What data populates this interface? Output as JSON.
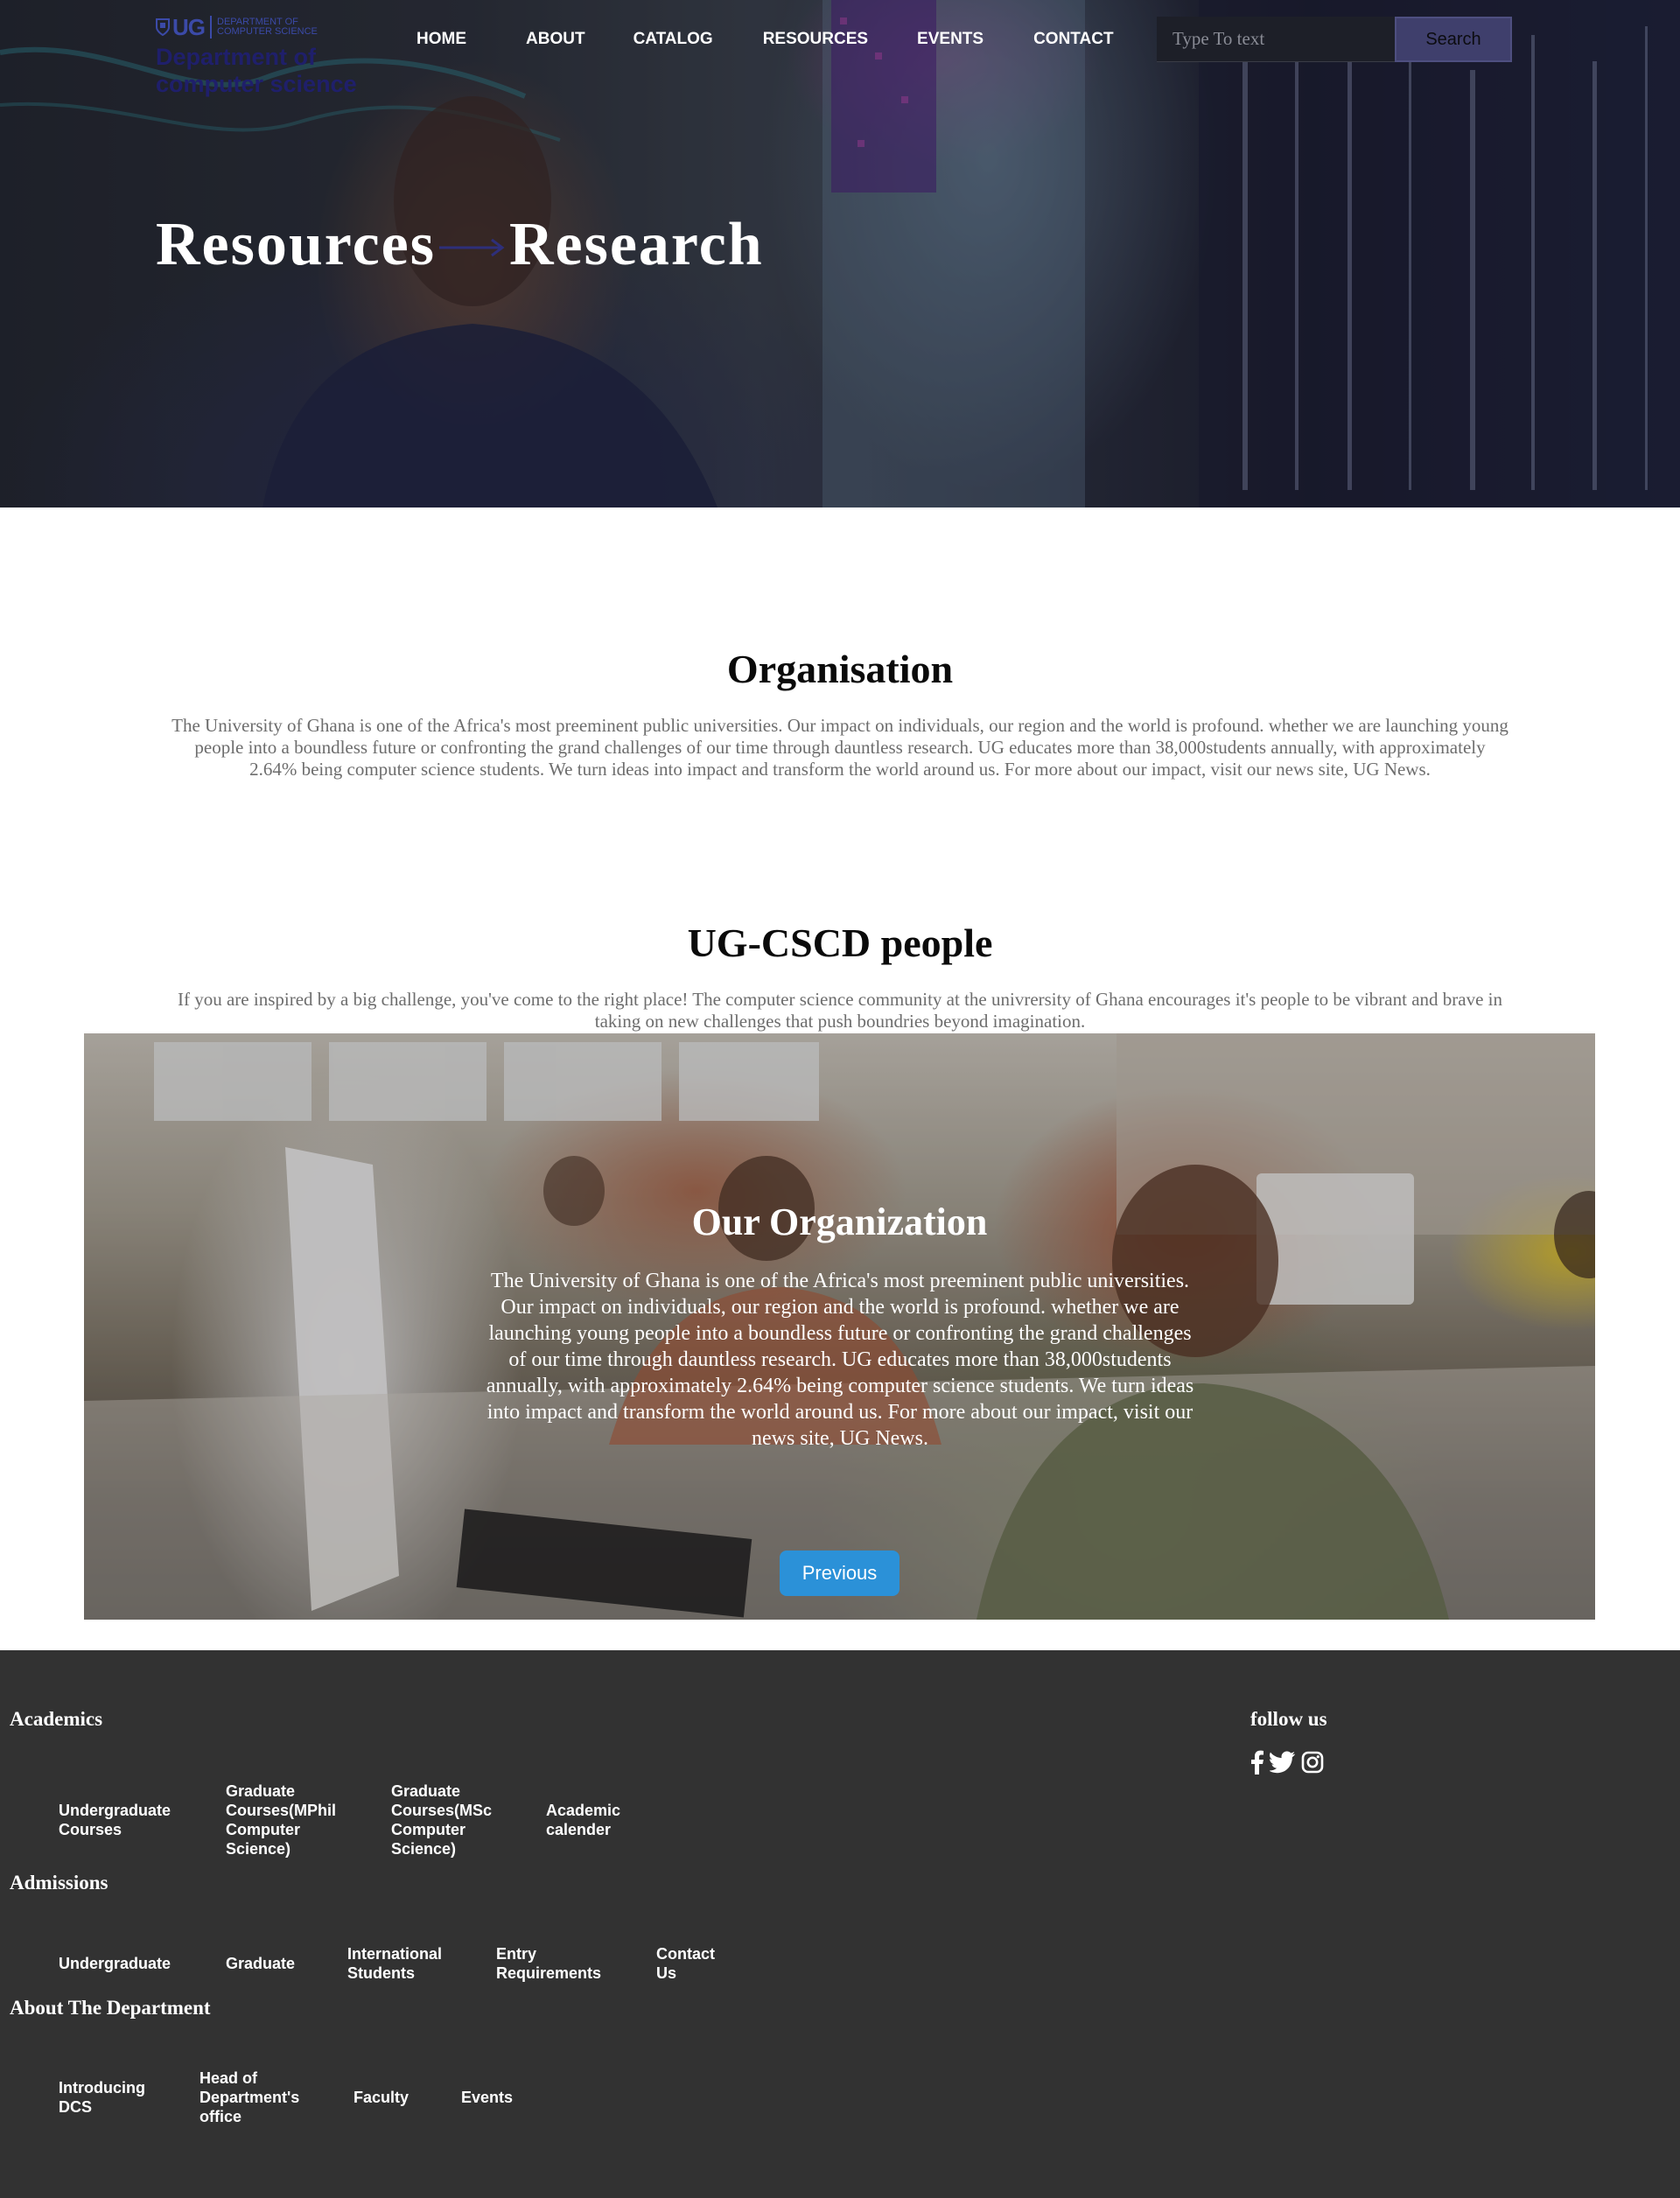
{
  "header": {
    "logo": {
      "short": "UG",
      "small_text": [
        "Department of",
        "computer science"
      ],
      "department": [
        "Department of",
        "computer science"
      ]
    },
    "nav": [
      "HOME",
      "ABOUT",
      "CATALOG",
      "RESOURCES",
      "EVENTS",
      "CONTACT"
    ],
    "search": {
      "placeholder": "Type To text",
      "button_label": "Search"
    }
  },
  "hero": {
    "breadcrumb": [
      "Resources",
      "Research"
    ],
    "arrow_icon": "arrow-right-icon"
  },
  "organisation": {
    "title": "Organisation",
    "text": "The University of Ghana is one of the Africa's most preeminent public universities. Our impact on individuals, our region and the world is profound. whether we are launching young people into a boundless future or confronting the grand challenges of our time through dauntless research. UG educates more than 38,000students annually, with approximately 2.64% being computer science students. We turn ideas into impact and transform the world around us. For more about our impact, visit our news site, UG News."
  },
  "people": {
    "title": "UG-CSCD people",
    "text": "If you are inspired by a big challenge, you've come to the right place! The computer science community at the univrersity of Ghana encourages it's people to be vibrant and brave in taking on new challenges that push boundries beyond imagination.",
    "slide": {
      "title": "Our Organization",
      "text": "The University of Ghana is one of the Africa's most preeminent public universities. Our impact on individuals, our region and the world is profound. whether we are launching young people into a boundless future or confronting the grand challenges of our time through dauntless research. UG educates more than 38,000students annually, with approximately 2.64% being computer science students. We turn ideas into impact and transform the world around us. For more about our impact, visit our news site, UG News.",
      "previous_label": "Previous"
    }
  },
  "footer": {
    "academics": {
      "heading": "Academics",
      "links": [
        "Undergraduate Courses",
        "Graduate Courses(MPhil Computer Science)",
        "Graduate Courses(MSc Computer Science)",
        "Academic calender"
      ]
    },
    "admissions": {
      "heading": "Admissions",
      "links": [
        "Undergraduate",
        "Graduate",
        "International Students",
        "Entry Requirements",
        "Contact Us"
      ]
    },
    "about": {
      "heading": "About The Department",
      "links": [
        "Introducing DCS",
        "Head of Department's office",
        "Faculty",
        "Events"
      ]
    },
    "follow": {
      "heading": "follow us",
      "icons": [
        "facebook-icon",
        "twitter-icon",
        "instagram-icon"
      ]
    }
  },
  "colors": {
    "nav_text": "#ffffff",
    "logo_blue": "#3b4aa8",
    "dept_text": "#1f1f6b",
    "search_button": "#3f3f6c",
    "previous_button": "#2b91d8",
    "footer_bg": "#323232",
    "body_text": "#6d6d6d"
  }
}
